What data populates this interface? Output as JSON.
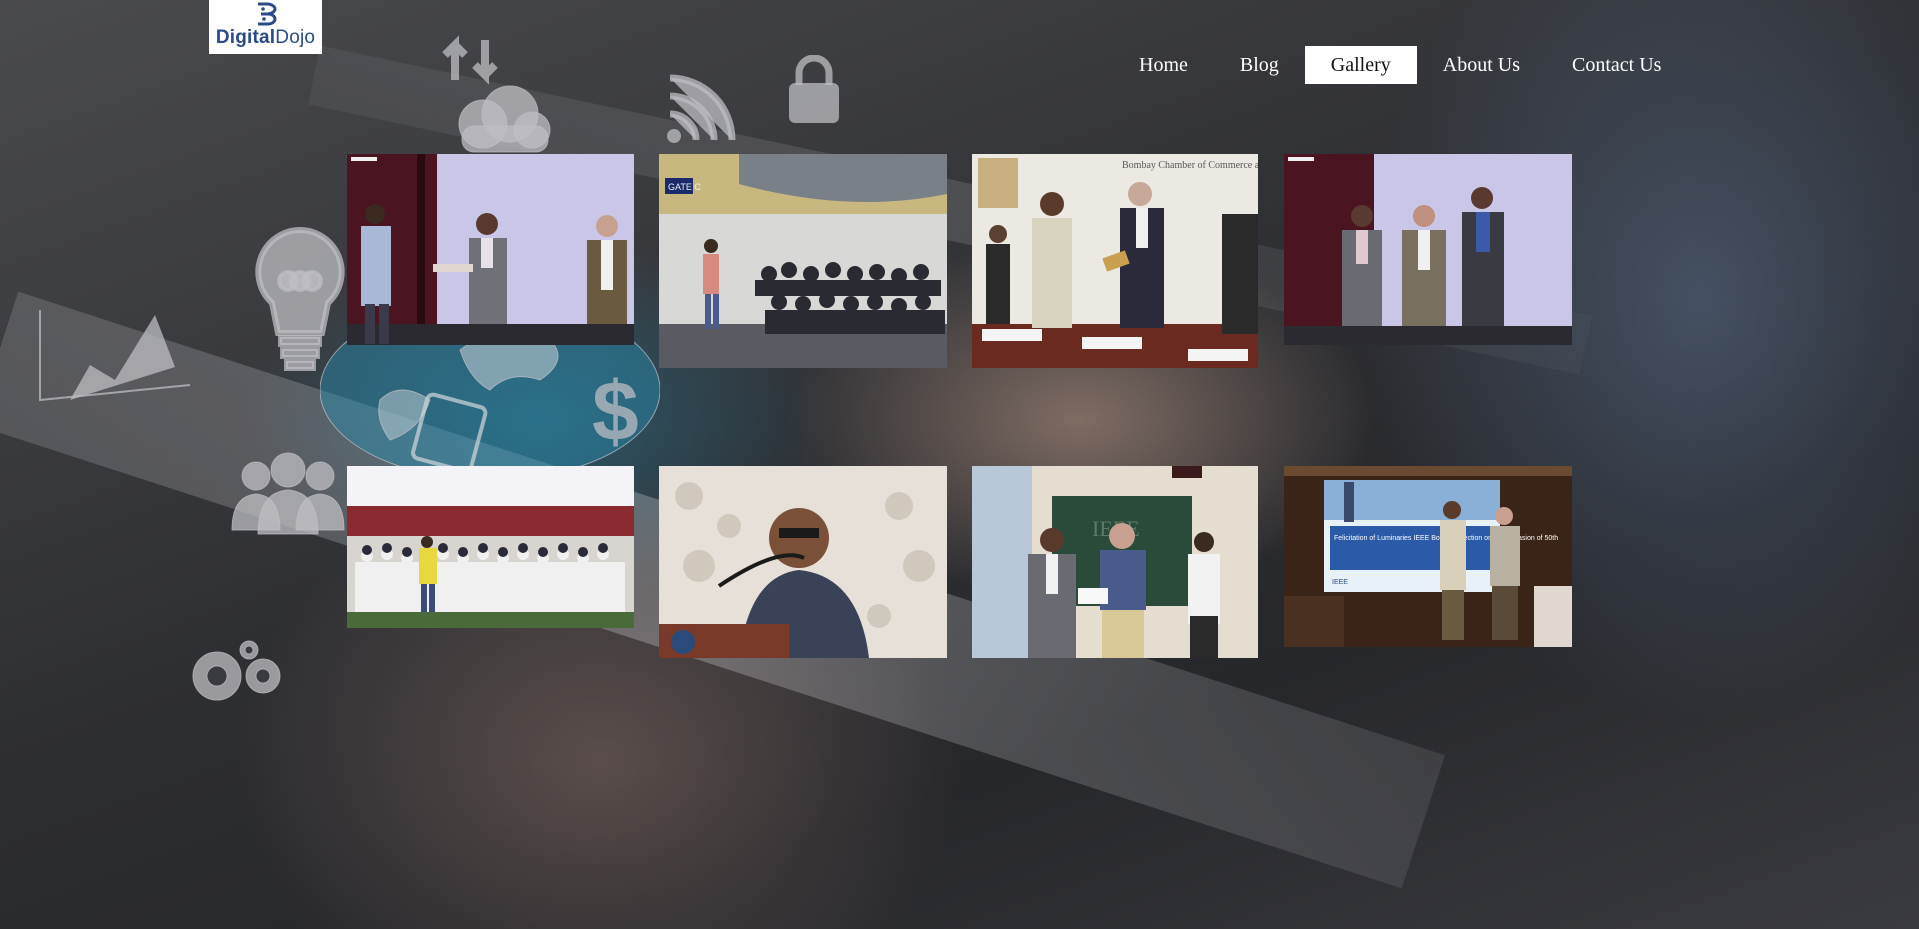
{
  "logo": {
    "text_bold": "Digital",
    "text_rest": "Dojo"
  },
  "nav": {
    "items": [
      {
        "label": "Home",
        "active": false
      },
      {
        "label": "Blog",
        "active": false
      },
      {
        "label": "Gallery",
        "active": true
      },
      {
        "label": "About Us",
        "active": false
      },
      {
        "label": "Contact Us",
        "active": false
      }
    ]
  },
  "gallery": {
    "photos": [
      {
        "name": "award-handshake-photo"
      },
      {
        "name": "seminar-audience-photo"
      },
      {
        "name": "chamber-of-commerce-photo"
      },
      {
        "name": "three-men-award-photo"
      },
      {
        "name": "auditorium-crowd-photo"
      },
      {
        "name": "speaker-at-podium-photo"
      },
      {
        "name": "certificate-presentation-photo"
      },
      {
        "name": "ieee-felicitation-photo"
      }
    ],
    "sign_texts": {
      "gate": "GATE C",
      "bombay_chamber": "Bombay Chamber of Commerce and Industry",
      "ieee_slide": "Felicitation of Luminaries IEEE Bombay Section on the Occasion of 50th",
      "ieee_logo": "IEEE"
    }
  },
  "colors": {
    "nav_active_bg": "#ffffff",
    "nav_text": "#ffffff",
    "logo_blue": "#2a4a8a"
  }
}
